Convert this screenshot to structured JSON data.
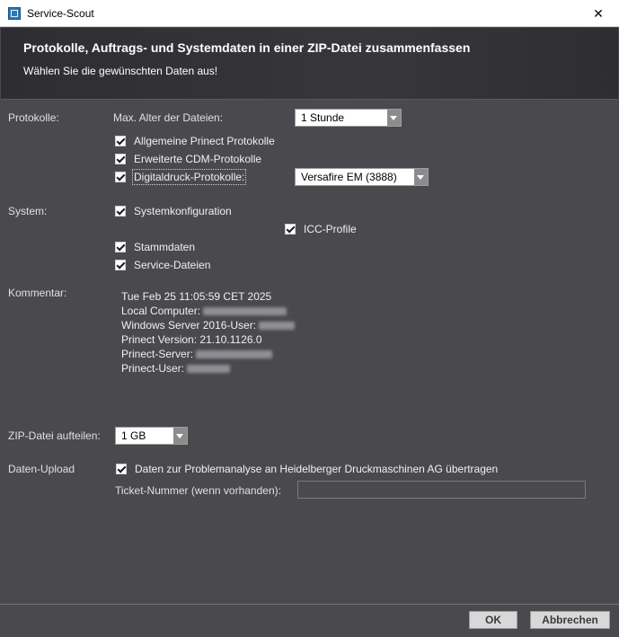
{
  "window": {
    "title": "Service-Scout",
    "close_glyph": "✕"
  },
  "header": {
    "title": "Protokolle, Auftrags- und Systemdaten in einer ZIP-Datei zusammenfassen",
    "subtitle": "Wählen Sie die gewünschten Daten aus!"
  },
  "protokolle": {
    "section_label": "Protokolle:",
    "age_label": "Max. Alter der Dateien:",
    "age_value": "1 Stunde",
    "cb_allgemein": "Allgemeine Prinect Protokolle",
    "cb_cdm": "Erweiterte CDM-Protokolle",
    "cb_digital": "Digitaldruck-Protokolle:",
    "digital_value": "Versafire EM (3888)"
  },
  "system": {
    "section_label": "System:",
    "cb_systemkonfiguration": "Systemkonfiguration",
    "cb_icc": "ICC-Profile",
    "cb_stammdaten": "Stammdaten",
    "cb_service": "Service-Dateien"
  },
  "kommentar": {
    "section_label": "Kommentar:",
    "date": "Tue Feb 25 11:05:59 CET 2025",
    "local_computer_label": "Local Computer:",
    "windows_user_label": "Windows Server 2016-User:",
    "version_label": "Prinect Version:",
    "version_value": "21.10.1126.0",
    "server_label": "Prinect-Server:",
    "user_label": "Prinect-User:"
  },
  "zip": {
    "label": "ZIP-Datei aufteilen:",
    "value": "1 GB"
  },
  "upload": {
    "section_label": "Daten-Upload",
    "cb_transfer": "Daten zur Problemanalyse an Heidelberger Druckmaschinen AG übertragen",
    "ticket_label": "Ticket-Nummer (wenn vorhanden):",
    "ticket_value": ""
  },
  "buttons": {
    "ok": "OK",
    "cancel": "Abbrechen"
  }
}
